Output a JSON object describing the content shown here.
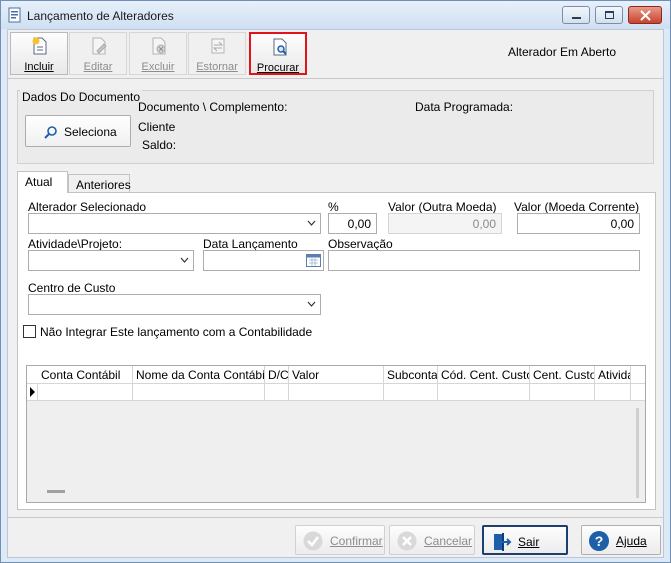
{
  "window": {
    "title": "Lançamento de Alteradores"
  },
  "toolbar": {
    "incluir": "Incluir",
    "editar": "Editar",
    "excluir": "Excluir",
    "estornar": "Estornar",
    "procurar": "Procurar",
    "status": "Alterador Em Aberto"
  },
  "document": {
    "group_title": "Dados Do Documento",
    "seleciona": "Seleciona",
    "documento_label": "Documento \\ Complemento:",
    "cliente_label": "Cliente",
    "saldo_label": "Saldo:",
    "data_programada_label": "Data Programada:"
  },
  "tabs": [
    "Atual",
    "Anteriores"
  ],
  "form": {
    "alterador_label": "Alterador Selecionado",
    "alterador_value": "",
    "percent_label": "%",
    "percent_value": "0,00",
    "valor_outra_label": "Valor (Outra Moeda)",
    "valor_outra_value": "0,00",
    "valor_corrente_label": "Valor (Moeda Corrente)",
    "valor_corrente_value": "0,00",
    "atividade_label": "Atividade\\Projeto:",
    "data_lanc_label": "Data Lançamento",
    "observacao_label": "Observação",
    "centro_label": "Centro de Custo",
    "nao_integrar_label": "Não Integrar Este lançamento com a Contabilidade",
    "nao_integrar_checked": false
  },
  "grid": {
    "columns": [
      "Conta Contábil",
      "Nome da Conta Contábil",
      "D/C",
      "Valor",
      "Subconta",
      "Cód. Cent. Custo",
      "Cent. Custo",
      "Atividade"
    ]
  },
  "buttons": {
    "confirmar": "Confirmar",
    "cancelar": "Cancelar",
    "sair": "Sair",
    "ajuda": "Ajuda"
  },
  "colors": {
    "highlight": "#e0151b",
    "accent": "#1d5fa8"
  },
  "icons": {
    "title": "form-icon",
    "incluir": "new-document-icon",
    "editar": "edit-document-icon",
    "excluir": "delete-document-icon",
    "estornar": "reverse-icon",
    "procurar": "search-document-icon",
    "seleciona": "magnifier-icon",
    "confirmar": "check-circle-icon",
    "cancelar": "cancel-circle-icon",
    "sair": "exit-door-icon",
    "ajuda": "help-icon"
  }
}
